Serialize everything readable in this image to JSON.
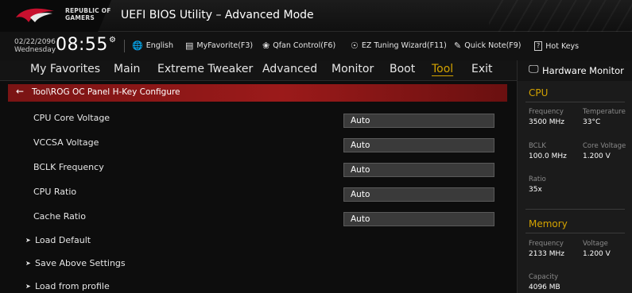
{
  "header": {
    "brand_line1": "REPUBLIC OF",
    "brand_line2": "GAMERS",
    "title": "UEFI BIOS Utility – Advanced Mode"
  },
  "toolbar": {
    "date": "02/22/2096",
    "day": "Wednesday",
    "time": "08:55",
    "items": [
      {
        "label": "English",
        "icon": "globe-icon"
      },
      {
        "label": "MyFavorite(F3)",
        "icon": "favorite-icon"
      },
      {
        "label": "Qfan Control(F6)",
        "icon": "fan-icon"
      },
      {
        "label": "EZ Tuning Wizard(F11)",
        "icon": "bulb-icon"
      },
      {
        "label": "Quick Note(F9)",
        "icon": "note-icon"
      },
      {
        "label": "Hot Keys",
        "icon": "help-icon"
      }
    ]
  },
  "nav": {
    "tabs": [
      "My Favorites",
      "Main",
      "Extreme Tweaker",
      "Advanced",
      "Monitor",
      "Boot",
      "Tool",
      "Exit"
    ],
    "active": "Tool"
  },
  "breadcrumb": "Tool\\ROG OC Panel H-Key Configure",
  "settings": [
    {
      "label": "CPU Core Voltage",
      "value": "Auto"
    },
    {
      "label": "VCCSA Voltage",
      "value": "Auto"
    },
    {
      "label": "BCLK Frequency",
      "value": "Auto"
    },
    {
      "label": "CPU Ratio",
      "value": "Auto"
    },
    {
      "label": "Cache Ratio",
      "value": "Auto"
    }
  ],
  "submenus": [
    "Load Default",
    "Save Above Settings",
    "Load from profile"
  ],
  "hardware_monitor": {
    "title": "Hardware Monitor",
    "cpu": {
      "section": "CPU",
      "frequency_label": "Frequency",
      "frequency": "3500 MHz",
      "temperature_label": "Temperature",
      "temperature": "33°C",
      "bclk_label": "BCLK",
      "bclk": "100.0 MHz",
      "core_voltage_label": "Core Voltage",
      "core_voltage": "1.200 V",
      "ratio_label": "Ratio",
      "ratio": "35x"
    },
    "memory": {
      "section": "Memory",
      "frequency_label": "Frequency",
      "frequency": "2133 MHz",
      "voltage_label": "Voltage",
      "voltage": "1.200 V",
      "capacity_label": "Capacity",
      "capacity": "4096 MB"
    }
  },
  "colors": {
    "accent": "#d4a300",
    "breadcrumb_red": "#9b1a1a"
  }
}
